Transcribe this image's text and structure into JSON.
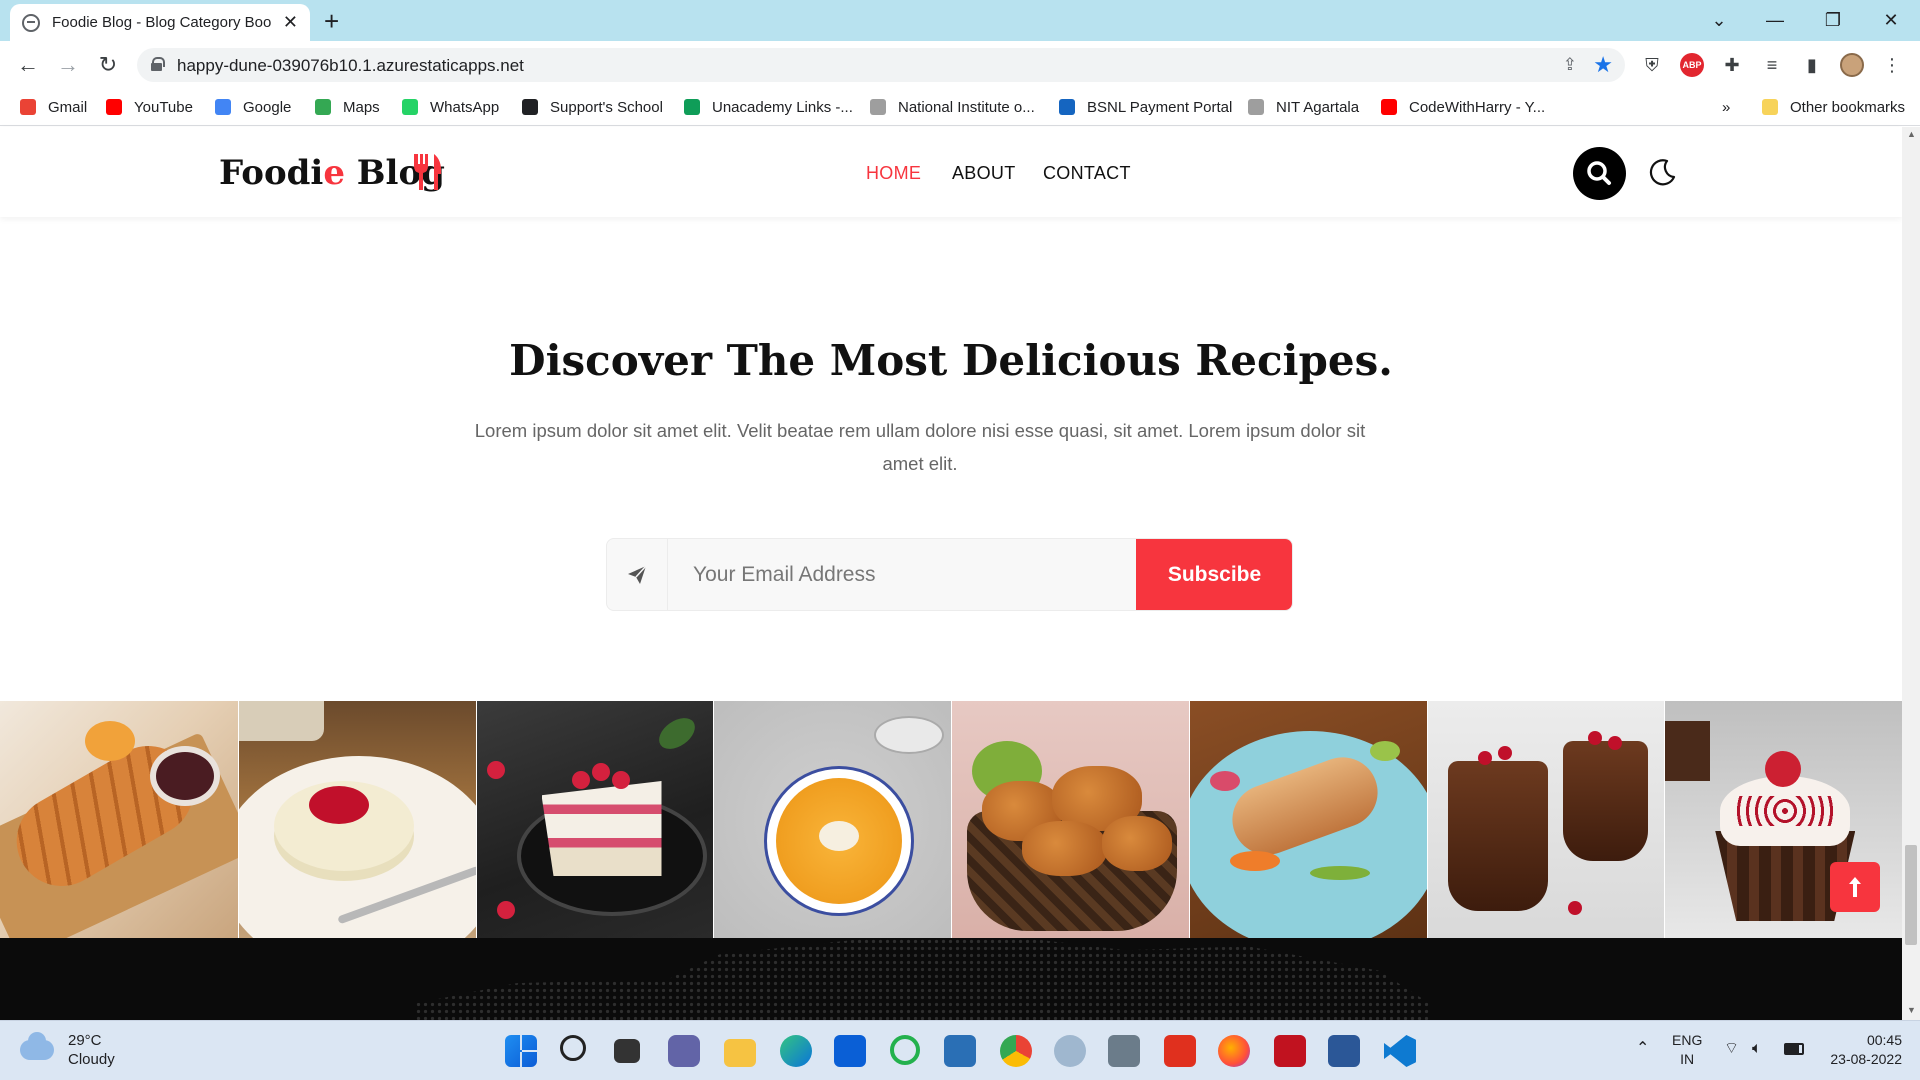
{
  "browser": {
    "tab_title": "Foodie Blog - Blog Category Boo",
    "url": "happy-dune-039076b10.1.azurestaticapps.net",
    "bookmarks": [
      {
        "label": "Gmail",
        "color": "#ea4335"
      },
      {
        "label": "YouTube",
        "color": "#ff0000"
      },
      {
        "label": "Google",
        "color": "#4285f4"
      },
      {
        "label": "Maps",
        "color": "#34a853"
      },
      {
        "label": "WhatsApp",
        "color": "#25d366"
      },
      {
        "label": "Support's School",
        "color": "#202124"
      },
      {
        "label": "Unacademy Links -...",
        "color": "#0f9d58"
      },
      {
        "label": "National Institute o...",
        "color": "#9e9e9e"
      },
      {
        "label": "BSNL Payment Portal",
        "color": "#1565c0"
      },
      {
        "label": "NIT Agartala",
        "color": "#9e9e9e"
      },
      {
        "label": "CodeWithHarry - Y...",
        "color": "#ff0000"
      }
    ],
    "more_bookmarks": "»",
    "other_bookmarks": "Other bookmarks"
  },
  "site": {
    "logo_main": "Foodi",
    "logo_accent": "e",
    "logo_end": " Blog",
    "nav": [
      "HOME",
      "ABOUT",
      "CONTACT"
    ],
    "accent_color": "#f7353e"
  },
  "hero": {
    "title": "Discover The Most Delicious Recipes.",
    "text": "Lorem ipsum dolor sit amet elit. Velit beatae rem ullam dolore nisi esse quasi, sit amet. Lorem ipsum dolor sit amet elit.",
    "email_placeholder": "Your Email Address",
    "subscribe_label": "Subscibe"
  },
  "gallery": [
    "bread",
    "panna-cotta",
    "raspberry-cake",
    "pumpkin-soup",
    "fried-chicken",
    "fish-plate",
    "chocolate-mousse",
    "chocolate-cupcake"
  ],
  "taskbar": {
    "temperature": "29°C",
    "weather": "Cloudy",
    "lang1": "ENG",
    "lang2": "IN",
    "time": "00:45",
    "date": "23-08-2022"
  }
}
